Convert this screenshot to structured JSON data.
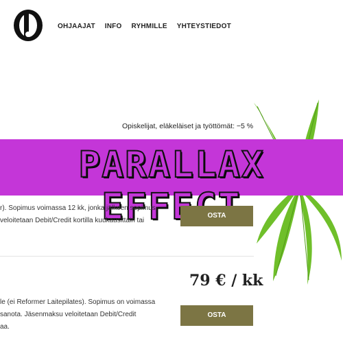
{
  "nav": {
    "items": [
      "OHJAAJAT",
      "INFO",
      "RYHMILLE",
      "YHTEYSTIEDOT"
    ]
  },
  "discount_text": "Opiskelijat, eläkeläiset ja työttömät: −5 %",
  "banner": {
    "text": "PARALLAX EFFECT"
  },
  "plan1": {
    "description_lines": [
      "r). Sopimus voimassa 12 kk, jonka jälkeen sopimus",
      "veloitetaan Debit/Credit kortilla kuukausittain tai"
    ],
    "buy_label": "OSTA"
  },
  "plan2": {
    "price": "79 € / kk",
    "description_lines": [
      "le (ei Reformer Laitepilates). Sopimus on voimassa",
      "sanota. Jäsenmaksu veloitetaan Debit/Credit",
      "aa."
    ],
    "buy_label": "OSTA"
  },
  "colors": {
    "banner": "#c436d8",
    "button": "#7c7544",
    "leaf": "#6fbf2a"
  },
  "icons": {
    "logo": "logo-icon",
    "leaf": "palm-leaf-decoration"
  }
}
